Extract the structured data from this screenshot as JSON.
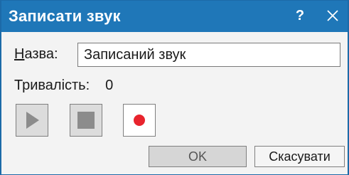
{
  "window": {
    "title": "Записати звук",
    "help_label": "?",
    "close_icon": "close-icon",
    "titlebar_color": "#1f77b8"
  },
  "name_field": {
    "label_mnemonic": "Н",
    "label_rest": "азва:",
    "value": "Записаний звук"
  },
  "duration": {
    "label": "Тривалість:",
    "value": "0"
  },
  "media_controls": [
    {
      "name": "play",
      "icon": "play-icon",
      "enabled": false
    },
    {
      "name": "stop",
      "icon": "stop-icon",
      "enabled": false
    },
    {
      "name": "record",
      "icon": "record-icon",
      "enabled": true,
      "color": "#e8242d"
    }
  ],
  "buttons": {
    "ok_label": "OK",
    "cancel_label": "Скасувати"
  }
}
